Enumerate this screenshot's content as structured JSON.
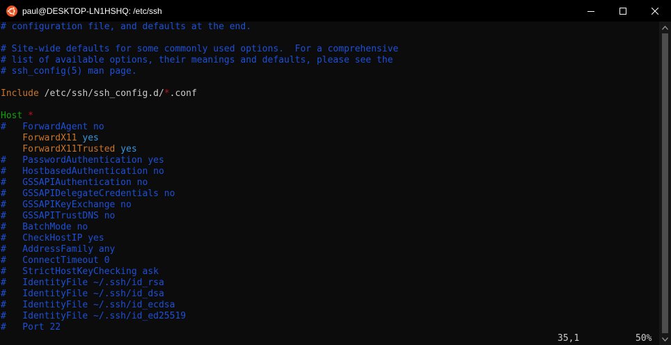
{
  "window": {
    "title": "paul@DESKTOP-LN1HSHQ: /etc/ssh",
    "icon": "ubuntu-icon",
    "colors": {
      "titlebar": "#000000",
      "background": "#0c0c0c",
      "comment": "#1e50d6",
      "keyword": "#c8752d",
      "value": "#3a96dd",
      "host": "#13a10e",
      "wildcard": "#c50f1f",
      "text": "#cccccc"
    }
  },
  "editor": {
    "lines": {
      "l1": {
        "a": "# configuration file, and defaults at the end."
      },
      "l2": {
        "a": ""
      },
      "l3": {
        "a": "# Site-wide defaults for some commonly used options.  For a comprehensive"
      },
      "l4": {
        "a": "# list of available options, their meanings and defaults, please see the"
      },
      "l5": {
        "a": "# ssh_config(5) man page."
      },
      "l6": {
        "a": ""
      },
      "l7": {
        "key": "Include",
        "v1": " /etc/ssh/ssh_config.d/",
        "star": "*",
        "v2": ".conf"
      },
      "l8": {
        "a": ""
      },
      "l9": {
        "key": "Host",
        "star": " *"
      },
      "l10": {
        "a": "#   ForwardAgent no"
      },
      "l11": {
        "key": "    ForwardX11",
        "val": " yes"
      },
      "l12": {
        "key": "    ForwardX11Trusted",
        "val": " yes"
      },
      "l13": {
        "a": "#   PasswordAuthentication yes"
      },
      "l14": {
        "a": "#   HostbasedAuthentication no"
      },
      "l15": {
        "a": "#   GSSAPIAuthentication no"
      },
      "l16": {
        "a": "#   GSSAPIDelegateCredentials no"
      },
      "l17": {
        "a": "#   GSSAPIKeyExchange no"
      },
      "l18": {
        "a": "#   GSSAPITrustDNS no"
      },
      "l19": {
        "a": "#   BatchMode no"
      },
      "l20": {
        "a": "#   CheckHostIP yes"
      },
      "l21": {
        "a": "#   AddressFamily any"
      },
      "l22": {
        "a": "#   ConnectTimeout 0"
      },
      "l23": {
        "a": "#   StrictHostKeyChecking ask"
      },
      "l24": {
        "a": "#   IdentityFile ~/.ssh/id_rsa"
      },
      "l25": {
        "a": "#   IdentityFile ~/.ssh/id_dsa"
      },
      "l26": {
        "a": "#   IdentityFile ~/.ssh/id_ecdsa"
      },
      "l27": {
        "a": "#   IdentityFile ~/.ssh/id_ed25519"
      },
      "l28": {
        "a": "#   Port 22"
      }
    },
    "status": {
      "cursor": "35,1",
      "percent": "50%"
    }
  }
}
